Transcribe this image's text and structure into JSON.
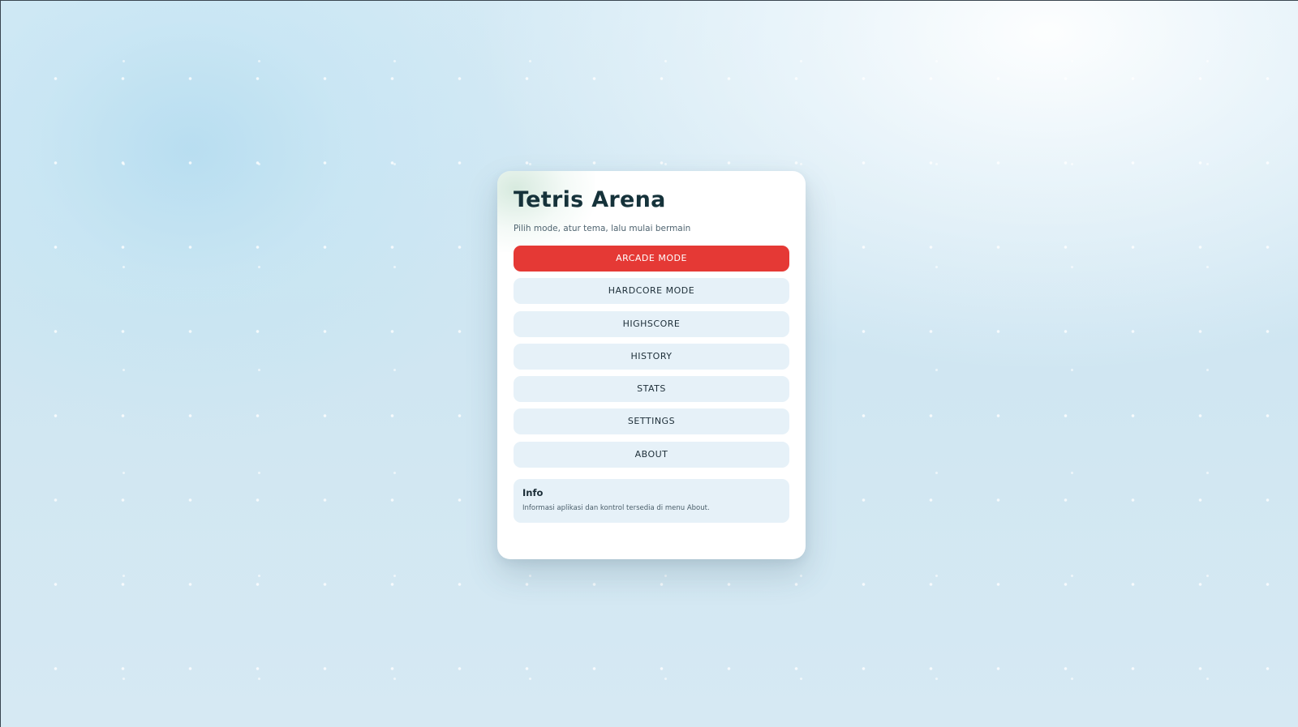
{
  "app": {
    "title": "Tetris Arena",
    "subtitle": "Pilih mode, atur tema, lalu mulai bermain"
  },
  "menu": {
    "items": [
      {
        "label": "ARCADE MODE",
        "primary": true
      },
      {
        "label": "HARDCORE MODE",
        "primary": false
      },
      {
        "label": "HIGHSCORE",
        "primary": false
      },
      {
        "label": "HISTORY",
        "primary": false
      },
      {
        "label": "STATS",
        "primary": false
      },
      {
        "label": "SETTINGS",
        "primary": false
      },
      {
        "label": "ABOUT",
        "primary": false
      }
    ]
  },
  "info": {
    "title": "Info",
    "text": "Informasi aplikasi dan kontrol tersedia di menu About."
  },
  "colors": {
    "accent": "#e53935",
    "button_bg": "#e6f1f8",
    "title_text": "#15323a",
    "background": "#d4eaf5"
  }
}
